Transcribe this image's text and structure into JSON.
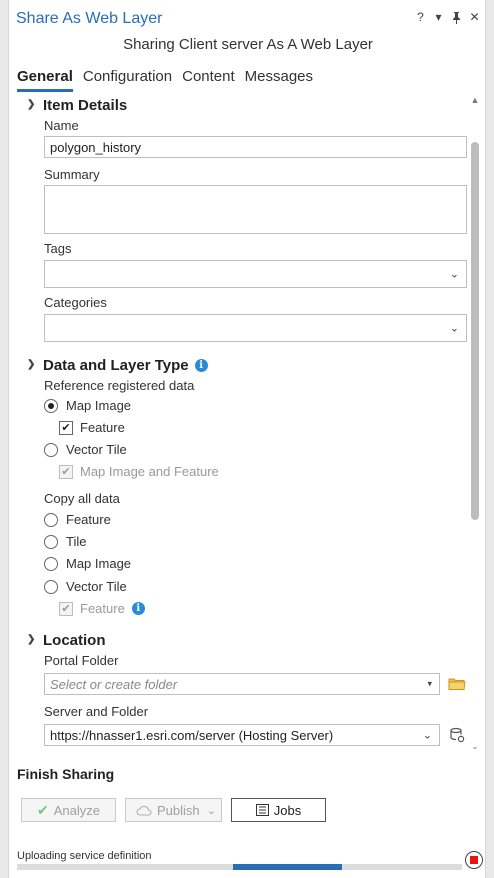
{
  "window": {
    "title": "Share As Web Layer",
    "subtitle": "Sharing Client server As A Web Layer",
    "controls": [
      "?",
      "▾",
      "⊥",
      "✕"
    ]
  },
  "tabs": [
    {
      "label": "General",
      "active": true
    },
    {
      "label": "Configuration",
      "active": false
    },
    {
      "label": "Content",
      "active": false
    },
    {
      "label": "Messages",
      "active": false
    }
  ],
  "item_details": {
    "heading": "Item Details",
    "name_label": "Name",
    "name_value": "polygon_history",
    "summary_label": "Summary",
    "summary_value": "",
    "tags_label": "Tags",
    "tags_value": "",
    "categories_label": "Categories",
    "categories_value": ""
  },
  "data_layer_type": {
    "heading": "Data and Layer Type",
    "reference_label": "Reference registered data",
    "ref_map_image": "Map Image",
    "ref_feature": "Feature",
    "ref_vector_tile": "Vector Tile",
    "ref_map_image_and_feature": "Map Image and Feature",
    "copy_label": "Copy all data",
    "copy_feature": "Feature",
    "copy_tile": "Tile",
    "copy_map_image": "Map Image",
    "copy_vector_tile": "Vector Tile",
    "copy_vt_feature": "Feature"
  },
  "location": {
    "heading": "Location",
    "portal_folder_label": "Portal Folder",
    "portal_folder_placeholder": "Select or create folder",
    "server_folder_label": "Server and Folder",
    "server_value": "https://hnasser1.esri.com/server (Hosting Server)"
  },
  "finish": {
    "heading": "Finish Sharing",
    "analyze_label": "Analyze",
    "publish_label": "Publish",
    "jobs_label": "Jobs"
  },
  "status": {
    "text": "Uploading service definition",
    "progress_start": 0.486,
    "progress_end": 0.73
  },
  "colors": {
    "accent": "#2a6db5",
    "info": "#2a89d8",
    "stop": "#ee1111"
  }
}
